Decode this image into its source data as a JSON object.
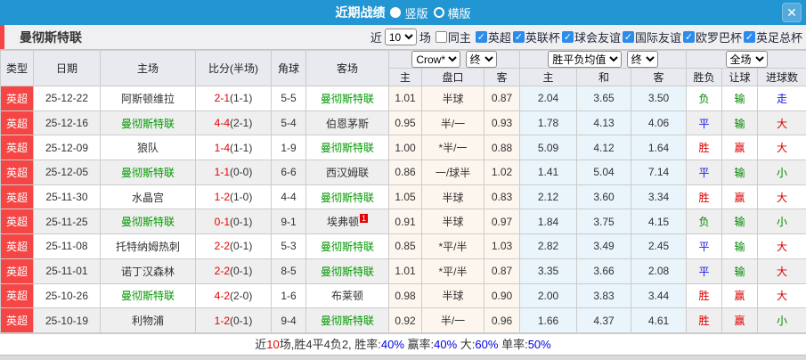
{
  "icons": {
    "check": "✓",
    "close": "✕"
  },
  "titlebar": {
    "title": "近期战绩",
    "radios": [
      {
        "label": "竖版",
        "selected": true
      },
      {
        "label": "横版",
        "selected": false
      }
    ]
  },
  "filter": {
    "team": "曼彻斯特联",
    "prefix": "近",
    "count": "10",
    "suffix": "场",
    "same_home": {
      "label": "同主",
      "checked": false
    },
    "leagues": [
      {
        "label": "英超",
        "checked": true
      },
      {
        "label": "英联杯",
        "checked": true
      },
      {
        "label": "球会友谊",
        "checked": true
      },
      {
        "label": "国际友谊",
        "checked": true
      },
      {
        "label": "欧罗巴杯",
        "checked": true
      },
      {
        "label": "英足总杯",
        "checked": true
      }
    ]
  },
  "table": {
    "selects": {
      "company": "Crow*",
      "company_stage": "终",
      "avg": "胜平负均值",
      "avg_stage": "终",
      "scope": "全场"
    },
    "columns": [
      "类型",
      "日期",
      "主场",
      "比分(半场)",
      "角球",
      "客场"
    ],
    "subcolumns": [
      "主",
      "盘口",
      "客",
      "主",
      "和",
      "客",
      "胜负",
      "让球",
      "进球数"
    ],
    "rows": [
      {
        "league": "英超",
        "date": "25-12-22",
        "home": "阿斯顿维拉",
        "home_target": false,
        "score": "2-1",
        "half": "(1-1)",
        "corners": "5-5",
        "away": "曼彻斯特联",
        "away_target": true,
        "away_card": "",
        "odds": [
          "1.01",
          "半球",
          "0.87"
        ],
        "avg": [
          "2.04",
          "3.65",
          "3.50"
        ],
        "results": [
          {
            "text": "负",
            "color": "green"
          },
          {
            "text": "输",
            "color": "green"
          },
          {
            "text": "走",
            "color": "blue"
          }
        ]
      },
      {
        "league": "英超",
        "date": "25-12-16",
        "home": "曼彻斯特联",
        "home_target": true,
        "score": "4-4",
        "half": "(2-1)",
        "corners": "5-4",
        "away": "伯恩茅斯",
        "away_target": false,
        "away_card": "",
        "odds": [
          "0.95",
          "半/一",
          "0.93"
        ],
        "avg": [
          "1.78",
          "4.13",
          "4.06"
        ],
        "results": [
          {
            "text": "平",
            "color": "blue"
          },
          {
            "text": "输",
            "color": "green"
          },
          {
            "text": "大",
            "color": "red"
          }
        ]
      },
      {
        "league": "英超",
        "date": "25-12-09",
        "home": "狼队",
        "home_target": false,
        "score": "1-4",
        "half": "(1-1)",
        "corners": "1-9",
        "away": "曼彻斯特联",
        "away_target": true,
        "away_card": "",
        "odds": [
          "1.00",
          "*半/一",
          "0.88"
        ],
        "avg": [
          "5.09",
          "4.12",
          "1.64"
        ],
        "results": [
          {
            "text": "胜",
            "color": "red"
          },
          {
            "text": "赢",
            "color": "red"
          },
          {
            "text": "大",
            "color": "red"
          }
        ]
      },
      {
        "league": "英超",
        "date": "25-12-05",
        "home": "曼彻斯特联",
        "home_target": true,
        "score": "1-1",
        "half": "(0-0)",
        "corners": "6-6",
        "away": "西汉姆联",
        "away_target": false,
        "away_card": "",
        "odds": [
          "0.86",
          "一/球半",
          "1.02"
        ],
        "avg": [
          "1.41",
          "5.04",
          "7.14"
        ],
        "results": [
          {
            "text": "平",
            "color": "blue"
          },
          {
            "text": "输",
            "color": "green"
          },
          {
            "text": "小",
            "color": "green"
          }
        ]
      },
      {
        "league": "英超",
        "date": "25-11-30",
        "home": "水晶宫",
        "home_target": false,
        "score": "1-2",
        "half": "(1-0)",
        "corners": "4-4",
        "away": "曼彻斯特联",
        "away_target": true,
        "away_card": "",
        "odds": [
          "1.05",
          "半球",
          "0.83"
        ],
        "avg": [
          "2.12",
          "3.60",
          "3.34"
        ],
        "results": [
          {
            "text": "胜",
            "color": "red"
          },
          {
            "text": "赢",
            "color": "red"
          },
          {
            "text": "大",
            "color": "red"
          }
        ]
      },
      {
        "league": "英超",
        "date": "25-11-25",
        "home": "曼彻斯特联",
        "home_target": true,
        "score": "0-1",
        "half": "(0-1)",
        "corners": "9-1",
        "away": "埃弗顿",
        "away_target": false,
        "away_card": "1",
        "odds": [
          "0.91",
          "半球",
          "0.97"
        ],
        "avg": [
          "1.84",
          "3.75",
          "4.15"
        ],
        "results": [
          {
            "text": "负",
            "color": "green"
          },
          {
            "text": "输",
            "color": "green"
          },
          {
            "text": "小",
            "color": "green"
          }
        ]
      },
      {
        "league": "英超",
        "date": "25-11-08",
        "home": "托特纳姆热刺",
        "home_target": false,
        "score": "2-2",
        "half": "(0-1)",
        "corners": "5-3",
        "away": "曼彻斯特联",
        "away_target": true,
        "away_card": "",
        "odds": [
          "0.85",
          "*平/半",
          "1.03"
        ],
        "avg": [
          "2.82",
          "3.49",
          "2.45"
        ],
        "results": [
          {
            "text": "平",
            "color": "blue"
          },
          {
            "text": "输",
            "color": "green"
          },
          {
            "text": "大",
            "color": "red"
          }
        ]
      },
      {
        "league": "英超",
        "date": "25-11-01",
        "home": "诺丁汉森林",
        "home_target": false,
        "score": "2-2",
        "half": "(0-1)",
        "corners": "8-5",
        "away": "曼彻斯特联",
        "away_target": true,
        "away_card": "",
        "odds": [
          "1.01",
          "*平/半",
          "0.87"
        ],
        "avg": [
          "3.35",
          "3.66",
          "2.08"
        ],
        "results": [
          {
            "text": "平",
            "color": "blue"
          },
          {
            "text": "输",
            "color": "green"
          },
          {
            "text": "大",
            "color": "red"
          }
        ]
      },
      {
        "league": "英超",
        "date": "25-10-26",
        "home": "曼彻斯特联",
        "home_target": true,
        "score": "4-2",
        "half": "(2-0)",
        "corners": "1-6",
        "away": "布莱顿",
        "away_target": false,
        "away_card": "",
        "odds": [
          "0.98",
          "半球",
          "0.90"
        ],
        "avg": [
          "2.00",
          "3.83",
          "3.44"
        ],
        "results": [
          {
            "text": "胜",
            "color": "red"
          },
          {
            "text": "赢",
            "color": "red"
          },
          {
            "text": "大",
            "color": "red"
          }
        ]
      },
      {
        "league": "英超",
        "date": "25-10-19",
        "home": "利物浦",
        "home_target": false,
        "score": "1-2",
        "half": "(0-1)",
        "corners": "9-4",
        "away": "曼彻斯特联",
        "away_target": true,
        "away_card": "",
        "odds": [
          "0.92",
          "半/一",
          "0.96"
        ],
        "avg": [
          "1.66",
          "4.37",
          "4.61"
        ],
        "results": [
          {
            "text": "胜",
            "color": "red"
          },
          {
            "text": "赢",
            "color": "red"
          },
          {
            "text": "小",
            "color": "green"
          }
        ]
      }
    ]
  },
  "footer": {
    "segments": [
      {
        "text": "近",
        "color": "dark"
      },
      {
        "text": "10",
        "color": "red"
      },
      {
        "text": "场,胜4平4负2, 胜率:",
        "color": "dark"
      },
      {
        "text": "40%",
        "color": "blue"
      },
      {
        "text": " 赢率:",
        "color": "dark"
      },
      {
        "text": "40%",
        "color": "blue"
      },
      {
        "text": " 大:",
        "color": "dark"
      },
      {
        "text": "60%",
        "color": "blue"
      },
      {
        "text": " 单率:",
        "color": "dark"
      },
      {
        "text": "50%",
        "color": "blue"
      }
    ]
  },
  "colors": {
    "accent_blue": "#2196d3",
    "league_red": "#f54545",
    "target_team_green": "#009900",
    "score_red": "#e60000",
    "result_red": "#dd0000",
    "result_green": "#008800",
    "result_blue": "#1a1ae6",
    "percent_blue": "#0000e6"
  }
}
